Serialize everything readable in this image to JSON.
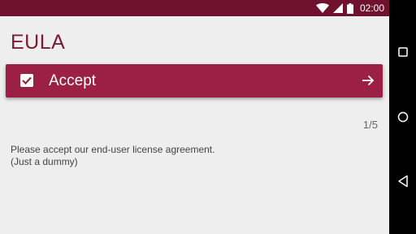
{
  "status_bar": {
    "time": "02:00",
    "icons": [
      "wifi-icon",
      "signal-icon",
      "battery-icon"
    ],
    "color": "#6f1230"
  },
  "page": {
    "title": "EULA",
    "accept_label": "Accept",
    "checkbox_checked": true,
    "page_indicator": "1/5",
    "body_line1": "Please accept our end-user license agreement.",
    "body_line2": "(Just a dummy)"
  },
  "nav": {
    "buttons": [
      "recents-icon",
      "home-icon",
      "back-icon"
    ]
  },
  "colors": {
    "accent": "#9c1f45",
    "title": "#7a1a35",
    "background": "#eeeeee"
  }
}
